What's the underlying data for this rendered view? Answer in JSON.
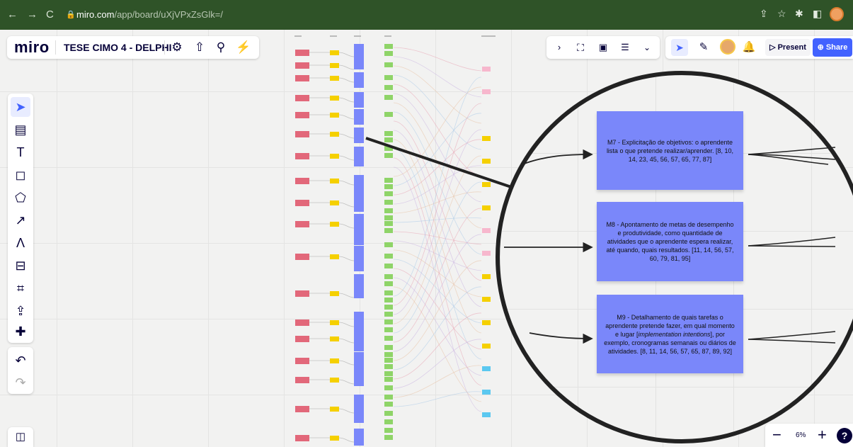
{
  "browser": {
    "url_host": "miro.com",
    "url_path": "/app/board/uXjVPxZsGlk=/"
  },
  "board": {
    "logo": "miro",
    "title": "TESE CIMO 4 - DELPHI"
  },
  "toolbar": {
    "present_label": "Present",
    "share_label": "Share"
  },
  "zoom": {
    "level": "6%"
  },
  "notes": [
    {
      "text": "M7 - Explicitação de objetivos: o  aprendente lista o que pretende realizar/aprender. [8, 10, 14, 23, 45, 56, 57, 65, 77, 87]"
    },
    {
      "text": "M8 - Apontamento de metas  de desempenho e produtividade, como quantidade de atividades que o aprendente espera realizar, até quando, quais resultados.  [11, 14, 56, 57, 60, 79, 81, 95]"
    },
    {
      "text_before": "M9 - Detalhamento de quais tarefas o aprendente pretende fazer, em qual momento e lugar [",
      "text_italic": "implementation intentions",
      "text_after": "], por exemplo,  cronogramas semanais ou diários de atividades.  [8, 11, 14, 56, 57, 65, 87, 89, 92]"
    }
  ],
  "colors": {
    "browser_chrome": "#2f5328",
    "note_fill": "#7a87fa",
    "accent": "#4262ff",
    "card_red": "#e2687a",
    "card_yellow": "#f5d000",
    "card_blue": "#7a87fa",
    "card_green": "#8fd468",
    "card_pink": "#f7b7cd",
    "card_cyan": "#5bc8f0"
  }
}
